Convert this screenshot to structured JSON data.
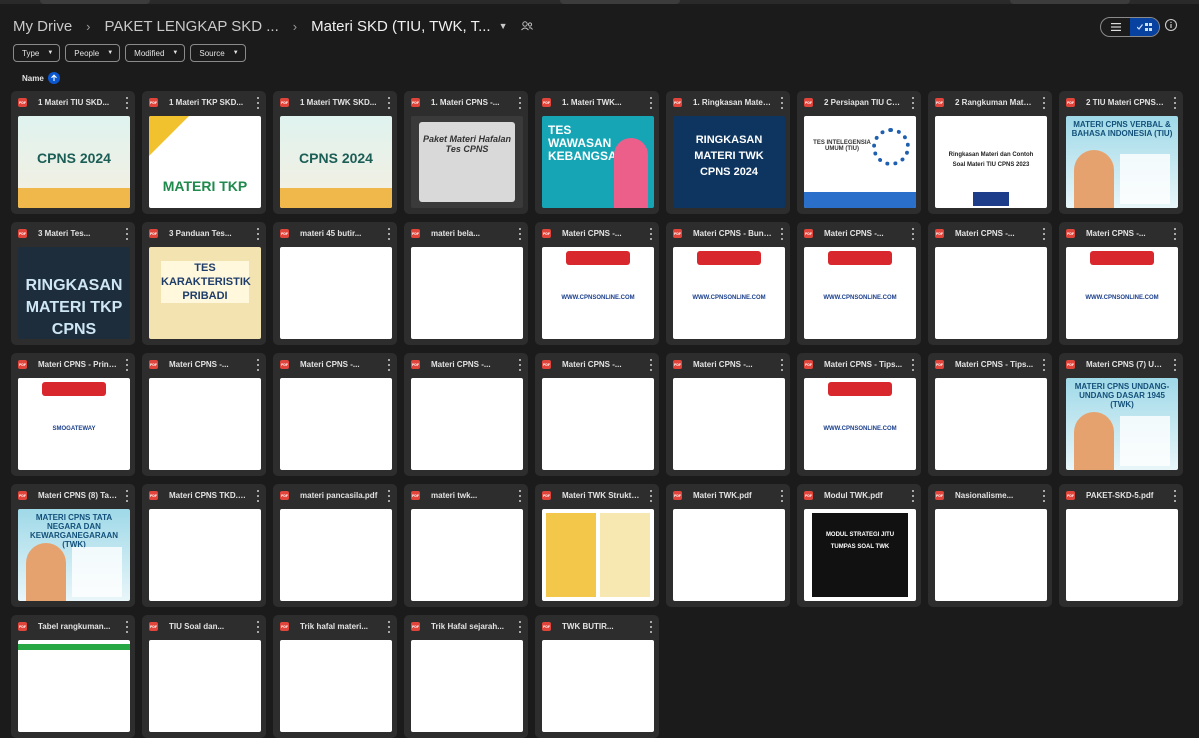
{
  "breadcrumb": {
    "root": "My Drive",
    "parent": "PAKET LENGKAP SKD ...",
    "current": "Materi SKD (TIU, TWK, T..."
  },
  "filters": {
    "type": "Type",
    "people": "People",
    "modified": "Modified",
    "source": "Source"
  },
  "sort": {
    "label": "Name"
  },
  "colors": {
    "background": "#1b1b1b",
    "card": "#2d2d2d",
    "accent": "#0b57d0",
    "pdf": "#e0443a"
  },
  "files": [
    {
      "title": "1 Materi TIU SKD...",
      "thumb": "cpns-gold",
      "caption": "CPNS 2024"
    },
    {
      "title": "1 Materi TKP SKD...",
      "thumb": "tkp",
      "caption": "MATERI TKP"
    },
    {
      "title": "1 Materi TWK SKD...",
      "thumb": "cpns-gold",
      "caption": "CPNS 2024"
    },
    {
      "title": "1. Materi CPNS -...",
      "thumb": "paket",
      "caption": "Paket Materi Hafalan Tes CPNS"
    },
    {
      "title": "1. Materi TWK...",
      "thumb": "wawasan",
      "caption": "TES WAWASAN KEBANGSAAN"
    },
    {
      "title": "1. Ringkasan Materi...",
      "thumb": "ringkasan-twk",
      "caption": "RINGKASAN MATERI TWK CPNS 2024"
    },
    {
      "title": "2 Persiapan TIU CPN...",
      "thumb": "tiu",
      "caption": "TES INTELEGENSIA UMUM (TIU)"
    },
    {
      "title": "2 Rangkuman Materi...",
      "thumb": "rangkuman",
      "caption": "Ringkasan Materi dan Contoh Soal Materi TIU CPNS 2023"
    },
    {
      "title": "2 TIU Materi CPNS (1...",
      "thumb": "hand",
      "caption": "MATERI CPNS VERBAL & BAHASA INDONESIA (TIU)"
    },
    {
      "title": "3 Materi Tes...",
      "thumb": "tkp-dark",
      "caption": "RINGKASAN MATERI TKP CPNS"
    },
    {
      "title": "3 Panduan Tes...",
      "thumb": "karakter",
      "caption": "TES KARAKTERISTIK PRIBADI"
    },
    {
      "title": "materi 45 butir...",
      "thumb": "doc",
      "caption": ""
    },
    {
      "title": "materi bela...",
      "thumb": "doc",
      "caption": ""
    },
    {
      "title": "Materi CPNS -...",
      "thumb": "cpnsonline",
      "caption": "WWW.CPNSONLINE.COM"
    },
    {
      "title": "Materi CPNS - Bund...",
      "thumb": "cpnsonline",
      "caption": "WWW.CPNSONLINE.COM"
    },
    {
      "title": "Materi CPNS -...",
      "thumb": "cpnsonline",
      "caption": "WWW.CPNSONLINE.COM"
    },
    {
      "title": "Materi CPNS -...",
      "thumb": "doc",
      "caption": ""
    },
    {
      "title": "Materi CPNS -...",
      "thumb": "cpnsonline",
      "caption": "WWW.CPNSONLINE.COM"
    },
    {
      "title": "Materi CPNS - Prinsi...",
      "thumb": "cpnsonline",
      "caption": "SMOGATEWAY"
    },
    {
      "title": "Materi CPNS -...",
      "thumb": "doc",
      "caption": ""
    },
    {
      "title": "Materi CPNS -...",
      "thumb": "doc",
      "caption": ""
    },
    {
      "title": "Materi CPNS -...",
      "thumb": "doc",
      "caption": ""
    },
    {
      "title": "Materi CPNS -...",
      "thumb": "doc",
      "caption": ""
    },
    {
      "title": "Materi CPNS -...",
      "thumb": "doc",
      "caption": ""
    },
    {
      "title": "Materi CPNS - Tips...",
      "thumb": "cpnsonline",
      "caption": "WWW.CPNSONLINE.COM"
    },
    {
      "title": "Materi CPNS - Tips...",
      "thumb": "doc",
      "caption": ""
    },
    {
      "title": "Materi CPNS (7) UU...",
      "thumb": "hand",
      "caption": "MATERI CPNS UNDANG-UNDANG DASAR 1945 (TWK)"
    },
    {
      "title": "Materi CPNS (8) Tat...",
      "thumb": "hand",
      "caption": "MATERI CPNS TATA NEGARA DAN KEWARGANEGARAAN (TWK)"
    },
    {
      "title": "Materi CPNS TKD.pdf",
      "thumb": "doc",
      "caption": ""
    },
    {
      "title": "materi pancasila.pdf",
      "thumb": "doc",
      "caption": ""
    },
    {
      "title": "materi twk...",
      "thumb": "doc",
      "caption": ""
    },
    {
      "title": "Materi TWK Struktur...",
      "thumb": "struktur",
      "caption": ""
    },
    {
      "title": "Materi TWK.pdf",
      "thumb": "doc",
      "caption": ""
    },
    {
      "title": "Modul TWK.pdf",
      "thumb": "modul",
      "caption": "MODUL STRATEGI JITU TUMPAS SOAL TWK"
    },
    {
      "title": "Nasionalisme...",
      "thumb": "doc",
      "caption": ""
    },
    {
      "title": "PAKET-SKD-5.pdf",
      "thumb": "doc",
      "caption": ""
    },
    {
      "title": "Tabel rangkuman...",
      "thumb": "tabel",
      "caption": ""
    },
    {
      "title": "TIU Soal dan...",
      "thumb": "blank",
      "caption": ""
    },
    {
      "title": "Trik hafal materi...",
      "thumb": "doc",
      "caption": ""
    },
    {
      "title": "Trik Hafal sejarah...",
      "thumb": "doc",
      "caption": ""
    },
    {
      "title": "TWK BUTIR...",
      "thumb": "doc",
      "caption": ""
    }
  ]
}
